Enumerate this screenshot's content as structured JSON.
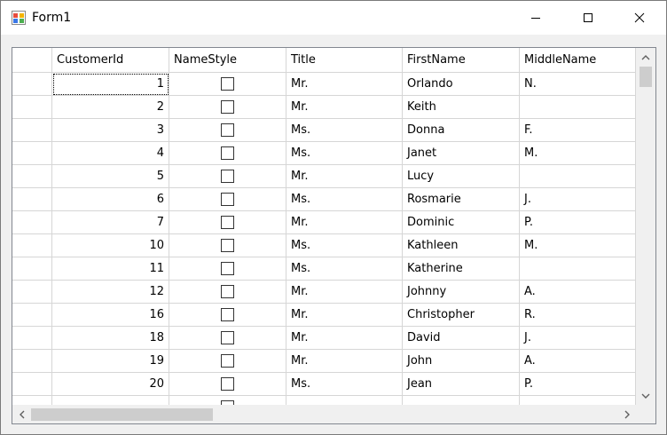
{
  "window": {
    "title": "Form1"
  },
  "grid": {
    "columns": [
      "CustomerId",
      "NameStyle",
      "Title",
      "FirstName",
      "MiddleName"
    ],
    "rows": [
      {
        "CustomerId": "1",
        "NameStyle": false,
        "Title": "Mr.",
        "FirstName": "Orlando",
        "MiddleName": "N."
      },
      {
        "CustomerId": "2",
        "NameStyle": false,
        "Title": "Mr.",
        "FirstName": "Keith",
        "MiddleName": ""
      },
      {
        "CustomerId": "3",
        "NameStyle": false,
        "Title": "Ms.",
        "FirstName": "Donna",
        "MiddleName": "F."
      },
      {
        "CustomerId": "4",
        "NameStyle": false,
        "Title": "Ms.",
        "FirstName": "Janet",
        "MiddleName": "M."
      },
      {
        "CustomerId": "5",
        "NameStyle": false,
        "Title": "Mr.",
        "FirstName": "Lucy",
        "MiddleName": ""
      },
      {
        "CustomerId": "6",
        "NameStyle": false,
        "Title": "Ms.",
        "FirstName": "Rosmarie",
        "MiddleName": "J."
      },
      {
        "CustomerId": "7",
        "NameStyle": false,
        "Title": "Mr.",
        "FirstName": "Dominic",
        "MiddleName": "P."
      },
      {
        "CustomerId": "10",
        "NameStyle": false,
        "Title": "Ms.",
        "FirstName": "Kathleen",
        "MiddleName": "M."
      },
      {
        "CustomerId": "11",
        "NameStyle": false,
        "Title": "Ms.",
        "FirstName": "Katherine",
        "MiddleName": ""
      },
      {
        "CustomerId": "12",
        "NameStyle": false,
        "Title": "Mr.",
        "FirstName": "Johnny",
        "MiddleName": "A."
      },
      {
        "CustomerId": "16",
        "NameStyle": false,
        "Title": "Mr.",
        "FirstName": "Christopher",
        "MiddleName": "R."
      },
      {
        "CustomerId": "18",
        "NameStyle": false,
        "Title": "Mr.",
        "FirstName": "David",
        "MiddleName": "J."
      },
      {
        "CustomerId": "19",
        "NameStyle": false,
        "Title": "Mr.",
        "FirstName": "John",
        "MiddleName": "A."
      },
      {
        "CustomerId": "20",
        "NameStyle": false,
        "Title": "Ms.",
        "FirstName": "Jean",
        "MiddleName": "P."
      },
      {
        "CustomerId": "",
        "NameStyle": false,
        "Title": "",
        "FirstName": "",
        "MiddleName": ""
      }
    ]
  },
  "icons": {
    "app": "form-icon",
    "minimize": "minimize-icon",
    "maximize": "maximize-icon",
    "close": "close-icon",
    "scroll_up": "chevron-up-icon",
    "scroll_down": "chevron-down-icon",
    "scroll_left": "chevron-left-icon",
    "scroll_right": "chevron-right-icon"
  },
  "colors": {
    "grid_background": "#ababab",
    "gridline": "#d6d6d6",
    "window_frame": "#f0f0f0"
  }
}
